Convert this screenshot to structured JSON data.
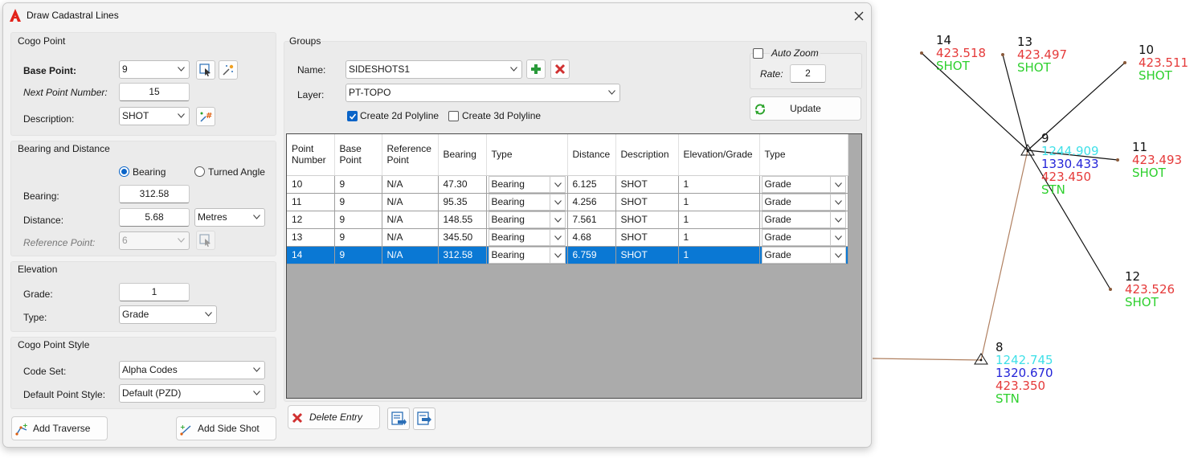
{
  "dialog": {
    "title": "Draw Cadastral Lines",
    "close_glyph": "✕"
  },
  "cogo_point": {
    "section_title": "Cogo Point",
    "base_point_label": "Base Point:",
    "base_point_value": "9",
    "next_point_label": "Next Point Number:",
    "next_point_value": "15",
    "description_label": "Description:",
    "description_value": "SHOT"
  },
  "bearing_distance": {
    "section_title": "Bearing and Distance",
    "radio_bearing": "Bearing",
    "radio_turned_angle": "Turned Angle",
    "selected_mode": "Bearing",
    "bearing_label": "Bearing:",
    "bearing_value": "312.58",
    "distance_label": "Distance:",
    "distance_value": "5.68",
    "distance_unit": "Metres",
    "reference_point_label": "Reference Point:",
    "reference_point_value": "6"
  },
  "elevation": {
    "section_title": "Elevation",
    "grade_label": "Grade:",
    "grade_value": "1",
    "type_label": "Type:",
    "type_value": "Grade"
  },
  "cogo_point_style": {
    "section_title": "Cogo Point Style",
    "code_set_label": "Code Set:",
    "code_set_value": "Alpha Codes",
    "default_style_label": "Default Point Style:",
    "default_style_value": "Default (PZD)"
  },
  "bottom_buttons": {
    "add_traverse": "Add Traverse",
    "add_side_shot": "Add Side Shot",
    "delete_entry": "Delete Entry"
  },
  "groups": {
    "section_title": "Groups",
    "name_label": "Name:",
    "name_value": "SIDESHOTS1",
    "layer_label": "Layer:",
    "layer_value": "PT-TOPO",
    "create_2d_label": "Create 2d Polyline",
    "create_2d_checked": true,
    "create_3d_label": "Create 3d Polyline",
    "create_3d_checked": false
  },
  "zoom": {
    "auto_zoom_label": "Auto Zoom",
    "auto_zoom_checked": false,
    "rate_label": "Rate:",
    "rate_value": "2",
    "update_label": "Update"
  },
  "table": {
    "headers": {
      "point_number": "Point Number",
      "base_point": "Base Point",
      "reference_point": "Reference Point",
      "bearing": "Bearing",
      "type": "Type",
      "distance": "Distance",
      "description": "Description",
      "elevation_grade": "Elevation/Grade",
      "type2": "Type"
    },
    "rows": [
      {
        "point": "10",
        "base": "9",
        "ref": "N/A",
        "bearing": "47.30",
        "type": "Bearing",
        "distance": "6.125",
        "desc": "SHOT",
        "elev": "1",
        "type2": "Grade"
      },
      {
        "point": "11",
        "base": "9",
        "ref": "N/A",
        "bearing": "95.35",
        "type": "Bearing",
        "distance": "4.256",
        "desc": "SHOT",
        "elev": "1",
        "type2": "Grade"
      },
      {
        "point": "12",
        "base": "9",
        "ref": "N/A",
        "bearing": "148.55",
        "type": "Bearing",
        "distance": "7.561",
        "desc": "SHOT",
        "elev": "1",
        "type2": "Grade"
      },
      {
        "point": "13",
        "base": "9",
        "ref": "N/A",
        "bearing": "345.50",
        "type": "Bearing",
        "distance": "4.68",
        "desc": "SHOT",
        "elev": "1",
        "type2": "Grade"
      },
      {
        "point": "14",
        "base": "9",
        "ref": "N/A",
        "bearing": "312.58",
        "type": "Bearing",
        "distance": "6.759",
        "desc": "SHOT",
        "elev": "1",
        "type2": "Grade"
      }
    ],
    "selected_row": "14"
  },
  "drawing": {
    "colors": {
      "line_black": "#111111",
      "line_brown": "#b08060",
      "red": "#e53a3a",
      "green": "#2ed02e",
      "cyan": "#3fe0e8",
      "blue": "#2424d8"
    },
    "p14": {
      "num": "14",
      "elev": "423.518",
      "desc": "SHOT"
    },
    "p13": {
      "num": "13",
      "elev": "423.497",
      "desc": "SHOT"
    },
    "p10": {
      "num": "10",
      "elev": "423.511",
      "desc": "SHOT"
    },
    "p9": {
      "num": "9",
      "north": "1244.909",
      "east": "1330.433",
      "elev": "423.450",
      "desc": "STN"
    },
    "p11": {
      "num": "11",
      "elev": "423.493",
      "desc": "SHOT"
    },
    "p12": {
      "num": "12",
      "elev": "423.526",
      "desc": "SHOT"
    },
    "p8": {
      "num": "8",
      "north": "1242.745",
      "east": "1320.670",
      "elev": "423.350",
      "desc": "STN"
    }
  }
}
